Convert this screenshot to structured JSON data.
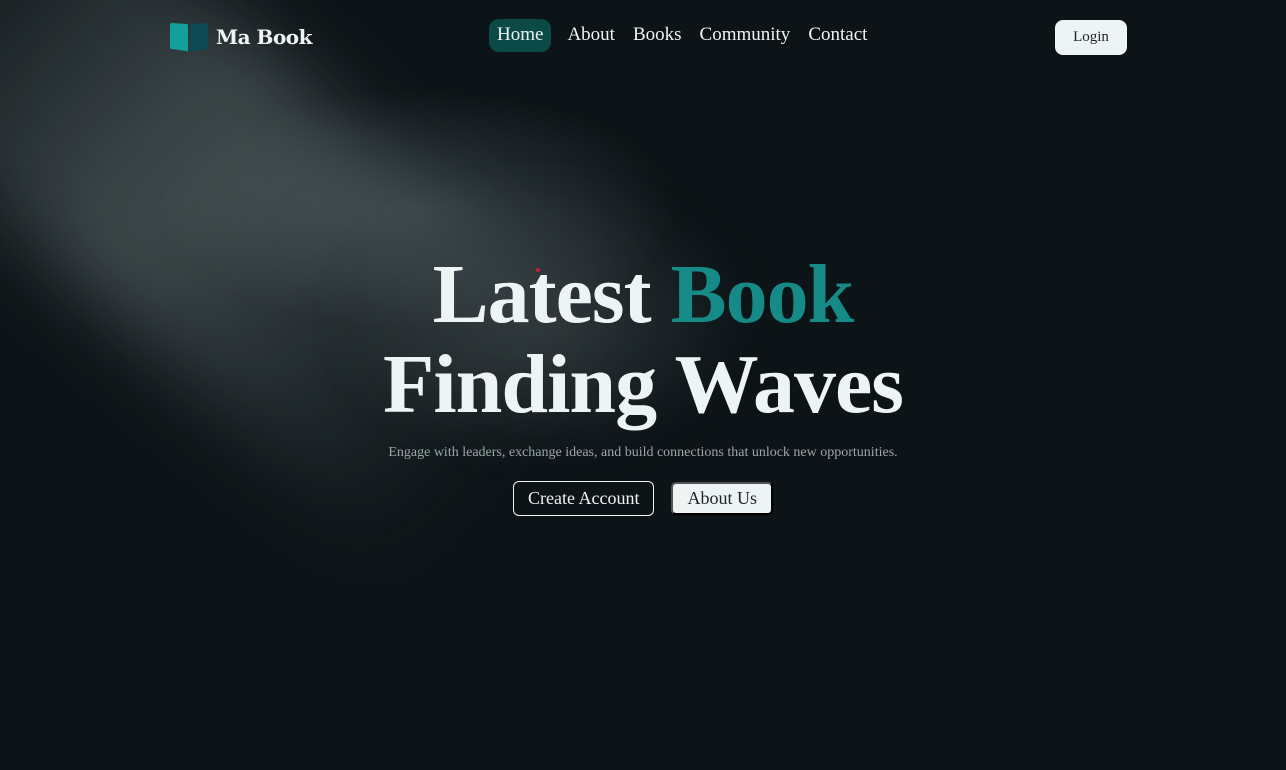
{
  "brand": {
    "name": "Ma Book",
    "icon": "open-book-icon",
    "icon_colors": [
      "#14a09a",
      "#0b4a55"
    ]
  },
  "nav": {
    "items": [
      {
        "label": "Home",
        "active": true
      },
      {
        "label": "About",
        "active": false
      },
      {
        "label": "Books",
        "active": false
      },
      {
        "label": "Community",
        "active": false
      },
      {
        "label": "Contact",
        "active": false
      }
    ],
    "login_label": "Login"
  },
  "hero": {
    "title_part1": "Latest",
    "title_accent": "Book",
    "title_line2": "Finding Waves",
    "subtitle": "Engage with leaders, exchange ideas, and build connections that unlock new opportunities.",
    "primary_button": "Create Account",
    "secondary_button": "About Us"
  },
  "colors": {
    "background": "#0c1417",
    "accent": "#168a86",
    "active_nav": "#0b4a47",
    "text": "#eef4f4"
  }
}
